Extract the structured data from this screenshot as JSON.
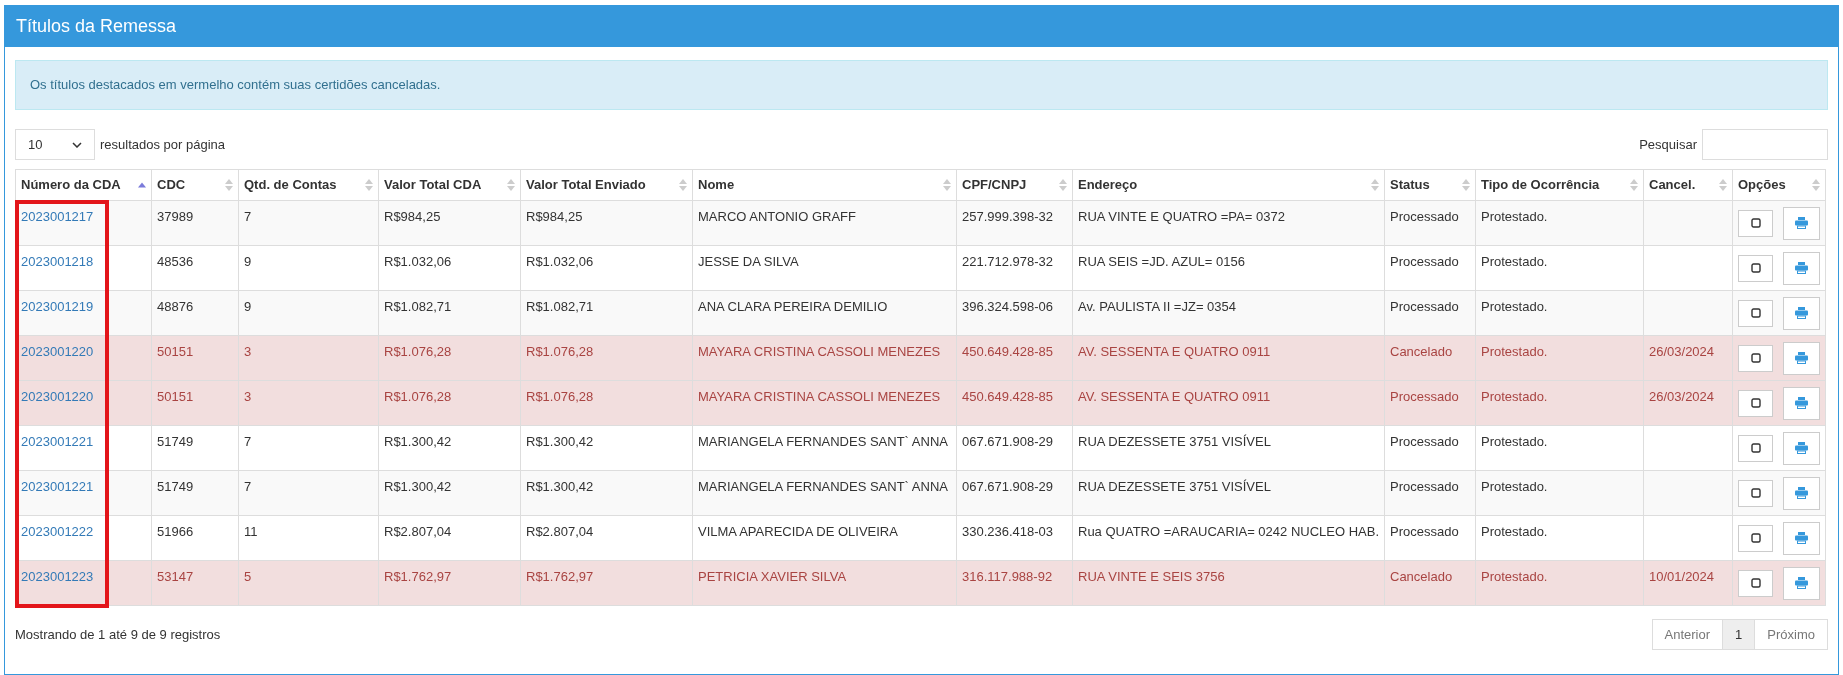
{
  "panel": {
    "title": "Títulos da Remessa"
  },
  "alert": "Os títulos destacados em vermelho contém suas certidões canceladas.",
  "length_menu": {
    "value": "10",
    "label": "resultados por página"
  },
  "search": {
    "label": "Pesquisar"
  },
  "table": {
    "columns": [
      {
        "label": "Número da CDA",
        "sorted": true
      },
      {
        "label": "CDC",
        "sorted": false
      },
      {
        "label": "Qtd. de Contas",
        "sorted": false
      },
      {
        "label": "Valor Total CDA",
        "sorted": false
      },
      {
        "label": "Valor Total Enviado",
        "sorted": false
      },
      {
        "label": "Nome",
        "sorted": false
      },
      {
        "label": "CPF/CNPJ",
        "sorted": false
      },
      {
        "label": "Endereço",
        "sorted": false
      },
      {
        "label": "Status",
        "sorted": false
      },
      {
        "label": "Tipo de Ocorrência",
        "sorted": false
      },
      {
        "label": "Cancel.",
        "sorted": false
      },
      {
        "label": "Opções",
        "sorted": false
      }
    ],
    "rows": [
      {
        "cancelled": false,
        "cells": [
          "2023001217",
          "37989",
          "7",
          "R$984,25",
          "R$984,25",
          "MARCO ANTONIO GRAFF",
          "257.999.398-32",
          "RUA VINTE E QUATRO =PA= 0372",
          "Processado",
          "Protestado.",
          ""
        ]
      },
      {
        "cancelled": false,
        "cells": [
          "2023001218",
          "48536",
          "9",
          "R$1.032,06",
          "R$1.032,06",
          "JESSE DA SILVA",
          "221.712.978-32",
          "RUA SEIS =JD. AZUL= 0156",
          "Processado",
          "Protestado.",
          ""
        ]
      },
      {
        "cancelled": false,
        "cells": [
          "2023001219",
          "48876",
          "9",
          "R$1.082,71",
          "R$1.082,71",
          "ANA CLARA PEREIRA DEMILIO",
          "396.324.598-06",
          "Av. PAULISTA II =JZ= 0354",
          "Processado",
          "Protestado.",
          ""
        ]
      },
      {
        "cancelled": true,
        "cells": [
          "2023001220",
          "50151",
          "3",
          "R$1.076,28",
          "R$1.076,28",
          "MAYARA CRISTINA CASSOLI MENEZES",
          "450.649.428-85",
          "AV. SESSENTA E QUATRO 0911",
          "Cancelado",
          "Protestado.",
          "26/03/2024"
        ]
      },
      {
        "cancelled": true,
        "cells": [
          "2023001220",
          "50151",
          "3",
          "R$1.076,28",
          "R$1.076,28",
          "MAYARA CRISTINA CASSOLI MENEZES",
          "450.649.428-85",
          "AV. SESSENTA E QUATRO 0911",
          "Processado",
          "Protestado.",
          "26/03/2024"
        ]
      },
      {
        "cancelled": false,
        "cells": [
          "2023001221",
          "51749",
          "7",
          "R$1.300,42",
          "R$1.300,42",
          "MARIANGELA FERNANDES SANT` ANNA",
          "067.671.908-29",
          "RUA DEZESSETE 3751 VISÍVEL",
          "Processado",
          "Protestado.",
          ""
        ]
      },
      {
        "cancelled": false,
        "cells": [
          "2023001221",
          "51749",
          "7",
          "R$1.300,42",
          "R$1.300,42",
          "MARIANGELA FERNANDES SANT` ANNA",
          "067.671.908-29",
          "RUA DEZESSETE 3751 VISÍVEL",
          "Processado",
          "Protestado.",
          ""
        ]
      },
      {
        "cancelled": false,
        "cells": [
          "2023001222",
          "51966",
          "11",
          "R$2.807,04",
          "R$2.807,04",
          "VILMA APARECIDA DE OLIVEIRA",
          "330.236.418-03",
          "Rua QUATRO =ARAUCARIA= 0242 NUCLEO HAB.",
          "Processado",
          "Protestado.",
          ""
        ]
      },
      {
        "cancelled": true,
        "cells": [
          "2023001223",
          "53147",
          "5",
          "R$1.762,97",
          "R$1.762,97",
          "PETRICIA XAVIER SILVA",
          "316.117.988-92",
          "RUA VINTE E SEIS 3756",
          "Cancelado",
          "Protestado.",
          "10/01/2024"
        ]
      }
    ]
  },
  "info": "Mostrando de 1 até 9 de 9 registros",
  "pagination": [
    {
      "label": "Anterior",
      "selected": false
    },
    {
      "label": "1",
      "selected": true
    },
    {
      "label": "Próximo",
      "selected": false
    }
  ]
}
